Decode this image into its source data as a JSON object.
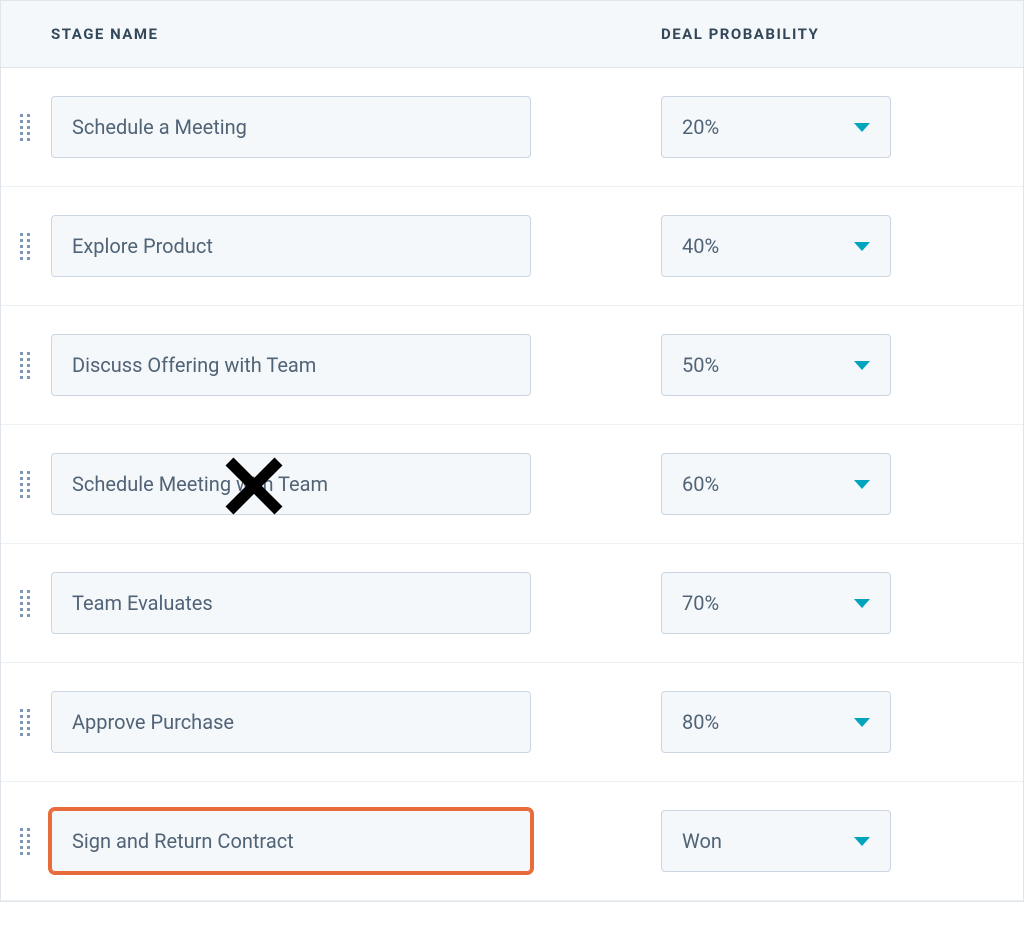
{
  "columns": {
    "stage_name": "STAGE NAME",
    "deal_probability": "DEAL PROBABILITY"
  },
  "rows": [
    {
      "stage": "Schedule a Meeting",
      "probability": "20%",
      "highlighted": false,
      "x_overlay": false
    },
    {
      "stage": "Explore Product",
      "probability": "40%",
      "highlighted": false,
      "x_overlay": false
    },
    {
      "stage": "Discuss Offering with Team",
      "probability": "50%",
      "highlighted": false,
      "x_overlay": false
    },
    {
      "stage": "Schedule Meeting with Team",
      "probability": "60%",
      "highlighted": false,
      "x_overlay": true
    },
    {
      "stage": "Team Evaluates",
      "probability": "70%",
      "highlighted": false,
      "x_overlay": false
    },
    {
      "stage": "Approve Purchase",
      "probability": "80%",
      "highlighted": false,
      "x_overlay": false
    },
    {
      "stage": "Sign and Return Contract",
      "probability": "Won",
      "highlighted": true,
      "x_overlay": false
    }
  ],
  "colors": {
    "accent_teal": "#00a4bd",
    "highlight_orange": "#e86c3b",
    "text": "#33475b",
    "field_bg": "#f5f8fa",
    "border": "#cbd6e2"
  }
}
